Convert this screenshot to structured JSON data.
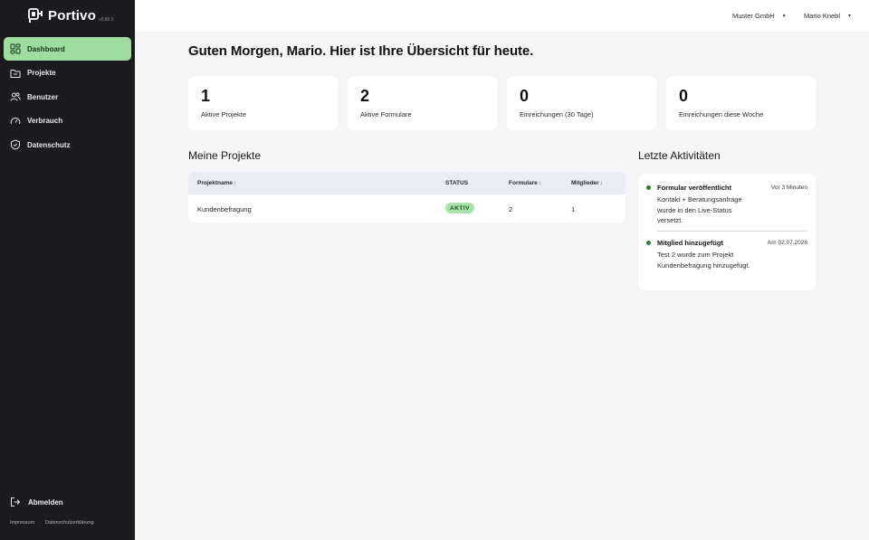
{
  "app": {
    "name": "Portivo",
    "version": "v0.80.0"
  },
  "sidebar": {
    "items": [
      {
        "label": "Dashboard",
        "icon": "dashboard-icon",
        "active": true
      },
      {
        "label": "Projekte",
        "icon": "folder-icon",
        "active": false
      },
      {
        "label": "Benutzer",
        "icon": "users-icon",
        "active": false
      },
      {
        "label": "Verbrauch",
        "icon": "gauge-icon",
        "active": false
      },
      {
        "label": "Datenschutz",
        "icon": "shield-icon",
        "active": false
      }
    ],
    "logout_label": "Abmelden",
    "footer": {
      "impressum": "Impressum",
      "separator": "·",
      "privacy": "Datenschutzerklärung"
    }
  },
  "topbar": {
    "company": "Muster GmbH",
    "user": "Mario Knebl",
    "caret": "▼"
  },
  "main": {
    "greeting": "Guten Morgen, Mario. Hier ist Ihre Übersicht für heute.",
    "stats": [
      {
        "value": "1",
        "label": "Aktive Projekte"
      },
      {
        "value": "2",
        "label": "Aktive Formulare"
      },
      {
        "value": "0",
        "label": "Einreichungen (30 Tage)"
      },
      {
        "value": "0",
        "label": "Einreichungen diese Woche"
      }
    ],
    "projects": {
      "title": "Meine Projekte",
      "columns": {
        "name": "Projektname",
        "status": "STATUS",
        "forms": "Formulare",
        "members": "Mitglieder",
        "sort": "↕"
      },
      "rows": [
        {
          "name": "Kundenbefragung",
          "status": "AKTIV",
          "forms": "2",
          "members": "1"
        }
      ]
    },
    "activities": {
      "title": "Letzte Aktivitäten",
      "items": [
        {
          "title": "Formular veröffentlicht",
          "time": "Vor 3 Minuten",
          "desc": "Kontakt + Beratungsanfrage wurde in den Live-Status versetzt."
        },
        {
          "title": "Mitglied hinzugefügt",
          "time": "Am 02.07.2026",
          "desc": "Test 2 wurde zum Projekt Kundenbefragung hinzugefügt."
        }
      ]
    }
  },
  "colors": {
    "sidebar_bg": "#1c1c20",
    "accent": "#9fdca0",
    "badge_bg": "#a7e2a8",
    "dot": "#2e7d32",
    "page_bg": "#f5f5f6"
  }
}
